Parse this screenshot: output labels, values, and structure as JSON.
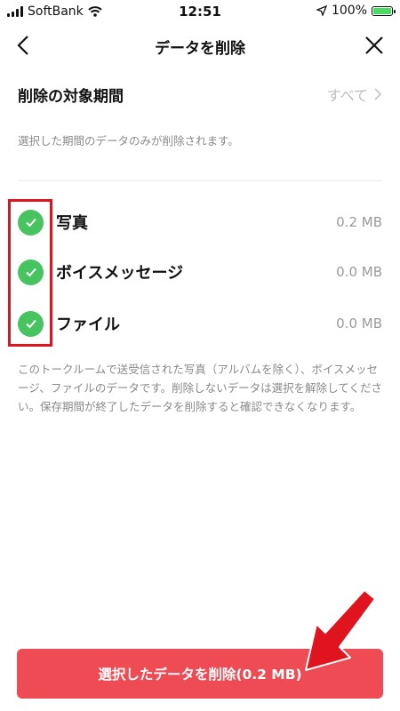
{
  "status_bar": {
    "carrier": "SoftBank",
    "time": "12:51",
    "battery": "100%"
  },
  "nav": {
    "title": "データを削除",
    "back_icon": "chevron-left-icon",
    "close_icon": "close-icon"
  },
  "period": {
    "label": "削除の対象期間",
    "value": "すべて"
  },
  "period_note": "選択した期間のデータのみが削除されます。",
  "items": [
    {
      "label": "写真",
      "size": "0.2 MB",
      "checked": true
    },
    {
      "label": "ボイスメッセージ",
      "size": "0.0 MB",
      "checked": true
    },
    {
      "label": "ファイル",
      "size": "0.0 MB",
      "checked": true
    }
  ],
  "note": "このトークルームで送受信された写真（アルバムを除く）、ボイスメッセージ、ファイルのデータです。削除しないデータは選択を解除してください。保存期間が終了したデータを削除すると確認できなくなります。",
  "delete_button": "選択したデータを削除(0.2 MB)",
  "colors": {
    "accent": "#ef4b55",
    "check": "#47c35f",
    "annotation": "#e0141e"
  }
}
